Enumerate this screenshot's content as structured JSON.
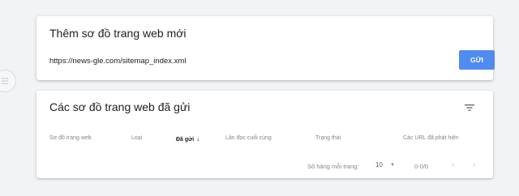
{
  "add_sitemap": {
    "title": "Thêm sơ đồ trang web mới",
    "url_value": "https://news-gle.com/sitemap_index.xml",
    "submit_label": "GỬI"
  },
  "submitted_sitemaps": {
    "title": "Các sơ đồ trang web đã gửi",
    "columns": [
      "Sơ đồ trang web",
      "Loại",
      "Đã gửi",
      "Lần đọc cuối cùng",
      "Trạng thái",
      "Các URL đã phát hiện"
    ],
    "sorted_column": "Đã gửi",
    "sort_direction": "descending"
  },
  "pagination": {
    "rows_per_page_label": "Số hàng mỗi trang:",
    "rows_per_page": "10",
    "range": "0-0/0"
  },
  "colors": {
    "accent": "#4f8bf0",
    "background": "#f1f3f4"
  },
  "icons": {
    "side": "menu-circle-icon",
    "filter": "filter-icon",
    "sort": "arrow-down-icon",
    "prev": "chevron-left-icon",
    "next": "chevron-right-icon"
  }
}
